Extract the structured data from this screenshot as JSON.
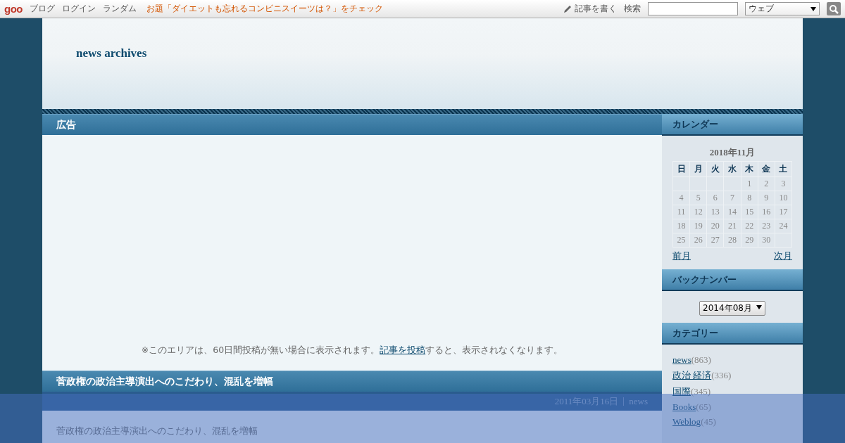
{
  "top_bar": {
    "logo": "goo",
    "links": [
      "ブログ",
      "ログイン",
      "ランダム"
    ],
    "topic": "お題「ダイエットも忘れるコンビニスイーツは？」をチェック",
    "write": "記事を書く",
    "search_label": "検索",
    "search_scope": "ウェブ"
  },
  "blog_title": "news archives",
  "ad": {
    "title": "広告",
    "notice_before": "※このエリアは、60日間投稿が無い場合に表示されます。",
    "notice_link": "記事を投稿",
    "notice_after": "すると、表示されなくなります。"
  },
  "entry": {
    "title": "菅政権の政治主導演出へのこだわり、混乱を増幅",
    "date": "2011年03月16日",
    "category": "news",
    "body": "菅政権の政治主導演出へのこだわり、混乱を増幅"
  },
  "calendar": {
    "title": "カレンダー",
    "month": "2018年11月",
    "weekdays": [
      "日",
      "月",
      "火",
      "水",
      "木",
      "金",
      "土"
    ],
    "weeks": [
      [
        {
          "kind": "empty"
        },
        {
          "kind": "empty"
        },
        {
          "kind": "empty"
        },
        {
          "kind": "empty"
        },
        {
          "kind": "day",
          "day": "1"
        },
        {
          "kind": "day",
          "day": "2"
        },
        {
          "kind": "day",
          "day": "3"
        }
      ],
      [
        {
          "kind": "day",
          "day": "4"
        },
        {
          "kind": "day",
          "day": "5"
        },
        {
          "kind": "day",
          "day": "6"
        },
        {
          "kind": "day",
          "day": "7"
        },
        {
          "kind": "day",
          "day": "8"
        },
        {
          "kind": "day",
          "day": "9"
        },
        {
          "kind": "day",
          "day": "10"
        }
      ],
      [
        {
          "kind": "day",
          "day": "11"
        },
        {
          "kind": "day",
          "day": "12"
        },
        {
          "kind": "day",
          "day": "13"
        },
        {
          "kind": "day",
          "day": "14"
        },
        {
          "kind": "day",
          "day": "15"
        },
        {
          "kind": "day",
          "day": "16"
        },
        {
          "kind": "day",
          "day": "17"
        }
      ],
      [
        {
          "kind": "day",
          "day": "18"
        },
        {
          "kind": "day",
          "day": "19"
        },
        {
          "kind": "day",
          "day": "20"
        },
        {
          "kind": "day",
          "day": "21"
        },
        {
          "kind": "day",
          "day": "22"
        },
        {
          "kind": "day",
          "day": "23"
        },
        {
          "kind": "day",
          "day": "24"
        }
      ],
      [
        {
          "kind": "day",
          "day": "25"
        },
        {
          "kind": "day",
          "day": "26"
        },
        {
          "kind": "day",
          "day": "27"
        },
        {
          "kind": "day",
          "day": "28"
        },
        {
          "kind": "day",
          "day": "29"
        },
        {
          "kind": "day",
          "day": "30"
        },
        {
          "kind": "empty"
        }
      ]
    ],
    "prev": "前月",
    "next": "次月"
  },
  "backnumber": {
    "title": "バックナンバー",
    "value": "2014年08月"
  },
  "categories": {
    "title": "カテゴリー",
    "items": [
      {
        "name": "news",
        "count": "(863)"
      },
      {
        "name": "政治 経済",
        "count": "(336)"
      },
      {
        "name": "国際",
        "count": "(345)"
      },
      {
        "name": "Books",
        "count": "(65)"
      },
      {
        "name": "Weblog",
        "count": "(45)"
      }
    ]
  }
}
